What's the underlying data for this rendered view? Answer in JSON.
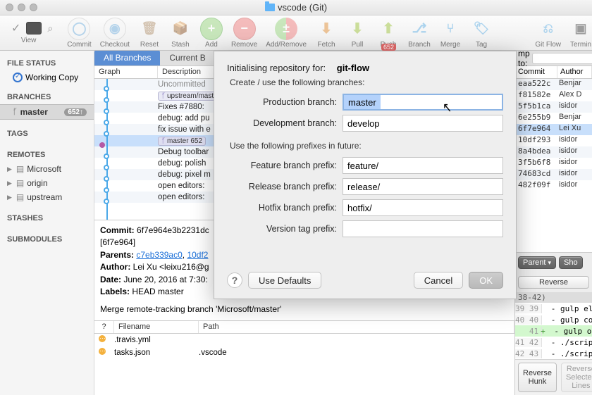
{
  "window": {
    "title": "vscode (Git)"
  },
  "toolbar": {
    "left_view_label": "View",
    "items": [
      {
        "label": "Commit"
      },
      {
        "label": "Checkout"
      },
      {
        "label": "Reset"
      },
      {
        "label": "Stash"
      },
      {
        "label": "Add"
      },
      {
        "label": "Remove"
      },
      {
        "label": "Add/Remove"
      },
      {
        "label": "Fetch"
      },
      {
        "label": "Pull"
      },
      {
        "label": "Push",
        "badge": "652"
      },
      {
        "label": "Branch"
      },
      {
        "label": "Merge"
      },
      {
        "label": "Tag"
      }
    ],
    "right_items": [
      {
        "label": "Git Flow"
      },
      {
        "label": "Terminal"
      }
    ]
  },
  "sidebar": {
    "file_status": "FILE STATUS",
    "working_copy": "Working Copy",
    "branches": "BRANCHES",
    "branch_items": [
      {
        "label": "master",
        "badge": "652↑"
      }
    ],
    "tags": "TAGS",
    "remotes": "REMOTES",
    "remote_items": [
      {
        "label": "Microsoft"
      },
      {
        "label": "origin"
      },
      {
        "label": "upstream"
      }
    ],
    "stashes": "STASHES",
    "submodules": "SUBMODULES"
  },
  "tabs": {
    "all": "All Branches",
    "current": "Current B"
  },
  "columns": {
    "graph": "Graph",
    "desc": "Description",
    "commit": "Commit",
    "author": "Author"
  },
  "commit_rows": [
    {
      "desc": "Uncommitted"
    },
    {
      "pill": "upstream/master",
      "desc": ""
    },
    {
      "desc": "Fixes #7880:"
    },
    {
      "desc": "debug: add pu"
    },
    {
      "desc": "fix issue with e"
    },
    {
      "pill": "master 652",
      "desc": ""
    },
    {
      "desc": "Debug toolbar"
    },
    {
      "desc": "debug: polish"
    },
    {
      "desc": "debug: pixel m"
    },
    {
      "desc": "open editors:"
    },
    {
      "desc": "open editors:"
    }
  ],
  "right_rows": [
    {
      "hash": "eaa522c",
      "author": "Benjar"
    },
    {
      "hash": "f81582e",
      "author": "Alex D"
    },
    {
      "hash": "5f5b1ca",
      "author": "isidor"
    },
    {
      "hash": "6e255b9",
      "author": "Benjar"
    },
    {
      "hash": "6f7e964",
      "author": "Lei Xu"
    },
    {
      "hash": "10df293",
      "author": "isidor"
    },
    {
      "hash": "8a4bdea",
      "author": "isidor"
    },
    {
      "hash": "3f5b6f8",
      "author": "isidor"
    },
    {
      "hash": "74683cd",
      "author": "isidor"
    },
    {
      "hash": "482f09f",
      "author": "isidor"
    }
  ],
  "jump": {
    "label": "mp to:"
  },
  "detail": {
    "commit_lbl": "Commit:",
    "commit_val": "6f7e964e3b2231dc",
    "commit_short": "[6f7e964]",
    "parents_lbl": "Parents:",
    "parent1": "c7eb339ac0",
    "parent2": "10df2",
    "author_lbl": "Author:",
    "author_val": "Lei Xu <leixu216@g",
    "date_lbl": "Date:",
    "date_val": "June 20, 2016 at 7:30:",
    "labels_lbl": "Labels:",
    "labels_val": "HEAD master",
    "message": "Merge remote-tracking branch 'Microsoft/master'"
  },
  "file_list": {
    "q": "?",
    "filename": "Filename",
    "path": "Path",
    "rows": [
      {
        "name": ".travis.yml",
        "path": ""
      },
      {
        "name": "tasks.json",
        "path": ".vscode"
      }
    ]
  },
  "right_buttons": {
    "parent": "Parent",
    "show": "Sho",
    "reverse": "Reverse"
  },
  "diff": {
    "range": "38-42)",
    "lines": [
      {
        "ln": "39 39",
        "t": " - gulp electron"
      },
      {
        "ln": "40 40",
        "t": " - gulp compile"
      },
      {
        "ln": "   41",
        "t": " - gulp optimize-vscode",
        "add": true
      },
      {
        "ln": "41 42",
        "t": " - ./scripts/test.sh"
      },
      {
        "ln": "42 43",
        "t": " - ./scripts/test-integration.sh"
      }
    ],
    "reverse_hunk": "Reverse Hunk",
    "reverse_sel": "Reverse Selected Lines"
  },
  "modal": {
    "title": "Initialising repository for:",
    "title_value": "git-flow",
    "sub1": "Create / use the following branches:",
    "prod_label": "Production branch:",
    "prod_value": "master",
    "dev_label": "Development branch:",
    "dev_value": "develop",
    "sub2": "Use the following prefixes in future:",
    "feature_label": "Feature branch prefix:",
    "feature_value": "feature/",
    "release_label": "Release branch prefix:",
    "release_value": "release/",
    "hotfix_label": "Hotfix branch prefix:",
    "hotfix_value": "hotfix/",
    "version_label": "Version tag prefix:",
    "version_value": "",
    "use_defaults": "Use Defaults",
    "cancel": "Cancel",
    "ok": "OK"
  }
}
